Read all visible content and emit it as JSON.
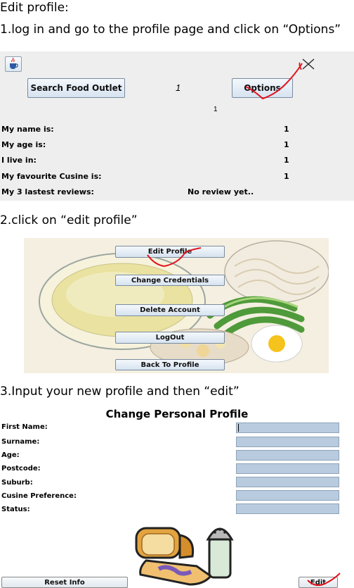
{
  "title": "Edit profile:",
  "steps": [
    "1.log in and go to the profile page and click on “Options”",
    "2.click on “edit profile”",
    "3.Input your new profile and then “edit”"
  ],
  "profile_page": {
    "search_button": "Search Food Outlet",
    "center_value": "1",
    "options_button": "Options",
    "sub_value": "1",
    "rows": [
      {
        "label": "My name is:",
        "value": "1"
      },
      {
        "label": "My age is:",
        "value": "1"
      },
      {
        "label": "I live in:",
        "value": "1"
      },
      {
        "label": "My favourite Cusine is:",
        "value": "1"
      },
      {
        "label": "My 3 lastest reviews:",
        "value": "No review yet.."
      }
    ]
  },
  "options_menu": {
    "buttons": [
      "Edit Profile",
      "Change Credentials",
      "Delete Account",
      "LogOut",
      "Back To Profile"
    ]
  },
  "edit_form": {
    "title": "Change Personal Profile",
    "fields": [
      "First Name:",
      "Surname:",
      "Age:",
      "Postcode:",
      "Suburb:",
      "Cusine Preference:",
      "Status:"
    ],
    "reset_button": "Reset Info",
    "edit_button": "Edit"
  },
  "colors": {
    "annotation": "#e0141e",
    "field": "#b8cbdf"
  }
}
